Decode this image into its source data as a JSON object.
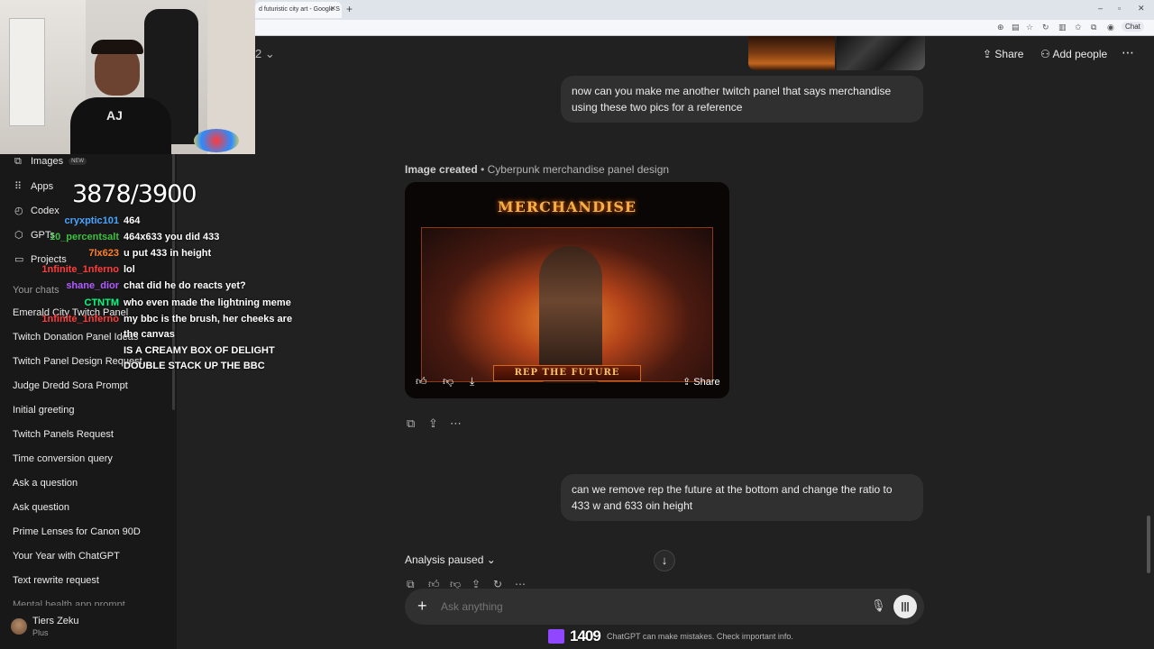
{
  "browser": {
    "tab_title": "d futuristic city art - Google S",
    "tab_close": "✕",
    "new_tab": "+",
    "chat_button": "Chat"
  },
  "webcam": {
    "shirt_text": "AJ"
  },
  "stream_overlay": {
    "counter": "3878/3900",
    "viewer_count": "1409",
    "chat": [
      {
        "user": "cryxptic101",
        "color": "#4aa3ff",
        "message": "464"
      },
      {
        "user": "10_percentsalt",
        "color": "#3fbf3f",
        "message": "464x633 you did 433"
      },
      {
        "user": "7lx623",
        "color": "#ff7f24",
        "message": "u put 433 in height"
      },
      {
        "user": "1nfinite_1nferno",
        "color": "#ff3b3b",
        "message": "lol"
      },
      {
        "user": "shane_dior",
        "color": "#b05cff",
        "message": "chat did he do reacts yet?"
      },
      {
        "user": "CTNTM",
        "color": "#00ff7f",
        "message": "who even made the lightning meme"
      },
      {
        "user": "1nfinite_1nferno",
        "color": "#ff3b3b",
        "message": "my bbc is the brush, her cheeks are"
      },
      {
        "user": "",
        "color": "#ffffff",
        "message": "the canvas"
      },
      {
        "user": "",
        "color": "#2424ff",
        "message": "IS A CREAMY BOX OF DELIGHT"
      },
      {
        "user": "",
        "color": "#ffffff",
        "message": "DOUBLE STACK UP THE BBC"
      }
    ]
  },
  "sidebar": {
    "nav": [
      {
        "icon": "⧉",
        "label": "Images",
        "badge": "NEW"
      },
      {
        "icon": "⠿",
        "label": "Apps"
      },
      {
        "icon": "◴",
        "label": "Codex"
      },
      {
        "icon": "⬡",
        "label": "GPTs"
      },
      {
        "icon": "▭",
        "label": "Projects"
      }
    ],
    "section_label": "Your chats",
    "chats": [
      "Emerald City Twitch Panel",
      "Twitch Donation Panel Ideas",
      "Twitch Panel Design Request",
      "Judge Dredd Sora Prompt",
      "Initial greeting",
      "Twitch Panels Request",
      "Time conversion query",
      "Ask a question",
      "Ask question",
      "Prime Lenses for Canon 90D",
      "Your Year with ChatGPT",
      "Text rewrite request",
      "Mental health app prompt"
    ],
    "user": {
      "name": "Tiers Zeku",
      "plan": "Plus"
    }
  },
  "header": {
    "model_suffix": "2",
    "share_label": "Share",
    "add_people_label": "Add people"
  },
  "conversation": {
    "user_msg_1": "now can you make me another twitch panel that says merchandise using these two pics for a reference",
    "image_created_label": "Image created",
    "image_created_title": "• Cyberpunk merchandise panel design",
    "panel_title": "MERCHANDISE",
    "panel_ribbon": "REP THE FUTURE",
    "image_share_label": "Share",
    "user_msg_2": "can we remove rep the future at the bottom and change the ratio to 433 w and 633 oin height",
    "analysis_label": "Analysis paused"
  },
  "composer": {
    "placeholder": "Ask anything",
    "disclaimer": "ChatGPT can make mistakes. Check important info."
  }
}
